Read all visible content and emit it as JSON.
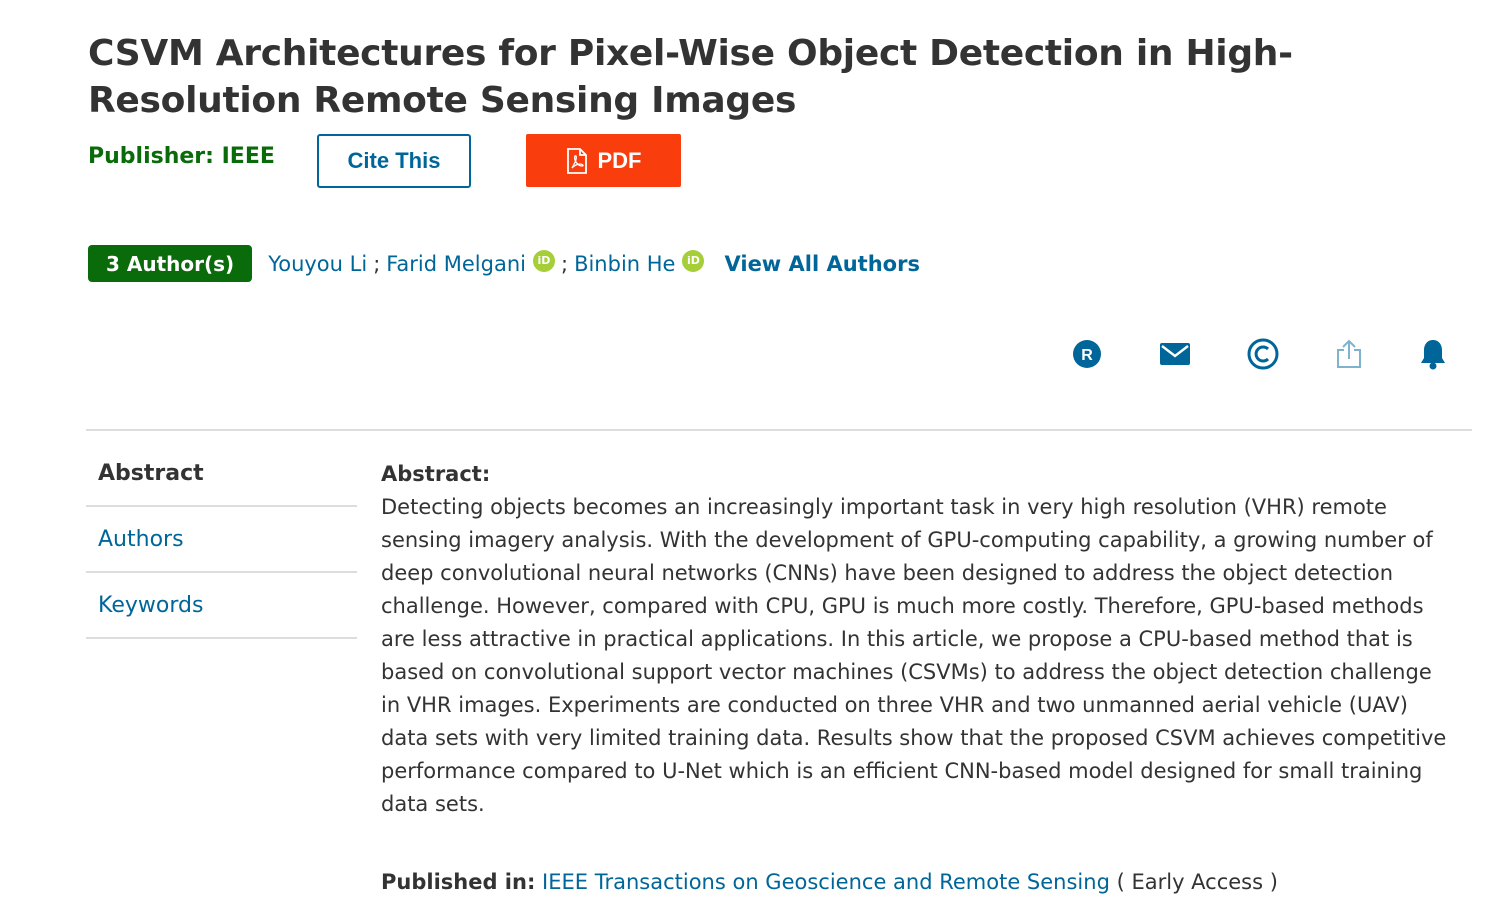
{
  "article": {
    "title": "CSVM Architectures for Pixel-Wise Object Detection in High-Resolution Remote Sensing Images",
    "publisher": "Publisher: IEEE"
  },
  "actions": {
    "cite_label": "Cite This",
    "pdf_label": "PDF"
  },
  "authors": {
    "count_label": "3 Author(s)",
    "list": [
      {
        "name": "Youyou Li",
        "orcid": false
      },
      {
        "name": "Farid Melgani",
        "orcid": true
      },
      {
        "name": "Binbin He",
        "orcid": true
      }
    ],
    "separator": ";",
    "orcid_label": "iD",
    "view_all_label": "View All Authors"
  },
  "tool_icons": [
    "rights-permissions-icon",
    "email-icon",
    "copyright-icon",
    "share-icon",
    "alert-bell-icon"
  ],
  "side_nav": {
    "items": [
      {
        "label": "Abstract",
        "active": true
      },
      {
        "label": "Authors",
        "active": false
      },
      {
        "label": "Keywords",
        "active": false
      }
    ]
  },
  "abstract": {
    "heading": "Abstract:",
    "text": "Detecting objects becomes an increasingly important task in very high resolution (VHR) remote sensing imagery analysis. With the development of GPU-computing capability, a growing number of deep convolutional neural networks (CNNs) have been designed to address the object detection challenge. However, compared with CPU, GPU is much more costly. Therefore, GPU-based methods are less attractive in practical applications. In this article, we propose a CPU-based method that is based on convolutional support vector machines (CSVMs) to address the object detection challenge in VHR images. Experiments are conducted on three VHR and two unmanned aerial vehicle (UAV) data sets with very limited training data. Results show that the proposed CSVM achieves competitive performance compared to U-Net which is an efficient CNN-based model designed for small training data sets."
  },
  "published_in": {
    "label": "Published in:",
    "journal": "IEEE Transactions on Geoscience and Remote Sensing",
    "status": "( Early Access )"
  },
  "colors": {
    "link": "#006699",
    "publisher_green": "#0a6b0a",
    "pdf_orange": "#fa3d0d",
    "orcid_green": "#a6ce39",
    "icon_blue": "#006699"
  }
}
